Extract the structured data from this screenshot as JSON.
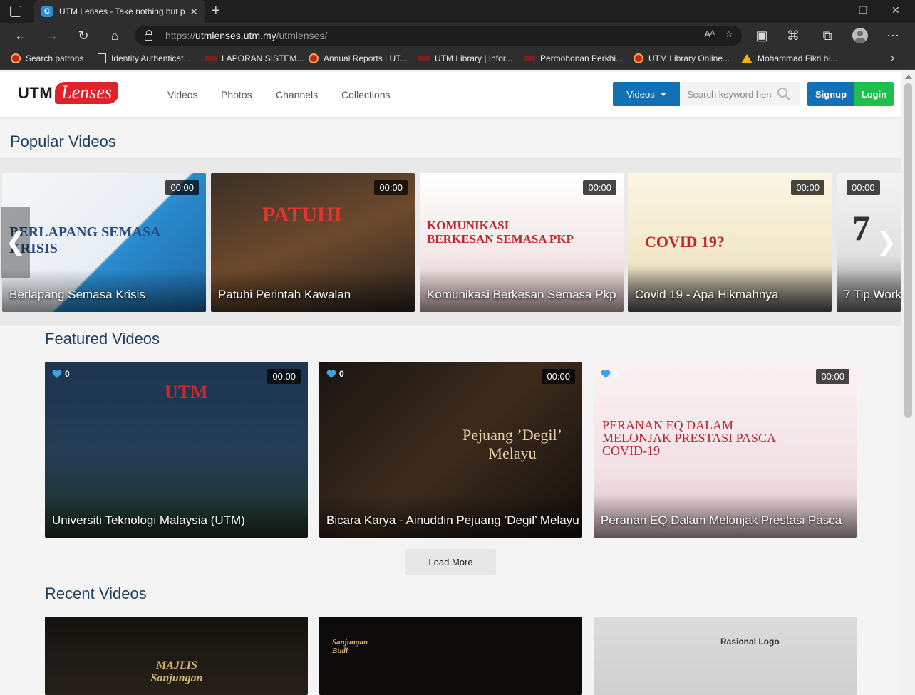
{
  "browser": {
    "tab_title": "UTM Lenses - Take nothing but pictures",
    "tab_close": "✕",
    "new_tab": "+",
    "url_host": "utmlenses.utm.my",
    "url_prefix": "https://",
    "url_path": "/utmlenses/",
    "reader_label": "A",
    "bookmarks": [
      {
        "label": "Search patrons",
        "icon": "utm-seal-icon"
      },
      {
        "label": "Identity Authenticat...",
        "icon": "document-icon"
      },
      {
        "label": "LAPORAN SISTEM...",
        "icon": "red-logo-icon"
      },
      {
        "label": "Annual Reports | UT...",
        "icon": "utm-seal-icon"
      },
      {
        "label": "UTM Library | Infor...",
        "icon": "red-logo-icon"
      },
      {
        "label": "Permohonan Perkhi...",
        "icon": "red-logo-icon"
      },
      {
        "label": "UTM Library Online...",
        "icon": "utm-seal-icon"
      },
      {
        "label": "Mohammad Fikri bi...",
        "icon": "google-drive-icon"
      }
    ]
  },
  "site": {
    "logo_utm": "UTM",
    "logo_lenses": "Lenses",
    "nav": [
      "Videos",
      "Photos",
      "Channels",
      "Collections"
    ],
    "search_category": "Videos",
    "search_placeholder": "Search keyword here",
    "signup": "Signup",
    "login": "Login"
  },
  "popular": {
    "title": "Popular Videos",
    "videos": [
      {
        "title": "Berlapang Semasa Krisis",
        "duration": "00:00",
        "art": "BERLAPANG SEMASA KRISIS"
      },
      {
        "title": "Patuhi Perintah Kawalan",
        "duration": "00:00",
        "art": "PATUHI"
      },
      {
        "title": "Komunikasi Berkesan Semasa Pkp",
        "duration": "00:00",
        "art": "KOMUNIKASI BERKESAN SEMASA PKP"
      },
      {
        "title": "Covid 19 - Apa Hikmahnya",
        "duration": "00:00",
        "art": "COVID 19?"
      },
      {
        "title": "7 Tip Work",
        "duration": "00:00",
        "art": "7"
      }
    ]
  },
  "featured": {
    "title": "Featured Videos",
    "videos": [
      {
        "title": "Universiti Teknologi Malaysia (UTM)",
        "duration": "00:00",
        "likes": "0",
        "art": "UTM"
      },
      {
        "title": "Bicara Karya - Ainuddin Pejuang ’Degil’ Melayu",
        "duration": "00:00",
        "likes": "0",
        "art": "Pejuang ’Degil’ Melayu"
      },
      {
        "title": "Peranan EQ Dalam Melonjak Prestasi Pasca",
        "duration": "00:00",
        "likes": "0",
        "art": "PERANAN EQ DALAM MELONJAK PRESTASI PASCA COVID-19"
      }
    ],
    "load_more": "Load More"
  },
  "recent": {
    "title": "Recent Videos",
    "art": [
      "MAJLIS Sanjungan",
      "Sanjungan Budi",
      "Rasional Logo"
    ]
  },
  "colors": {
    "brand_blue": "#1271b5",
    "login_green": "#1fbf4e",
    "title_navy": "#1d3f5f",
    "logo_red": "#e0232b"
  }
}
